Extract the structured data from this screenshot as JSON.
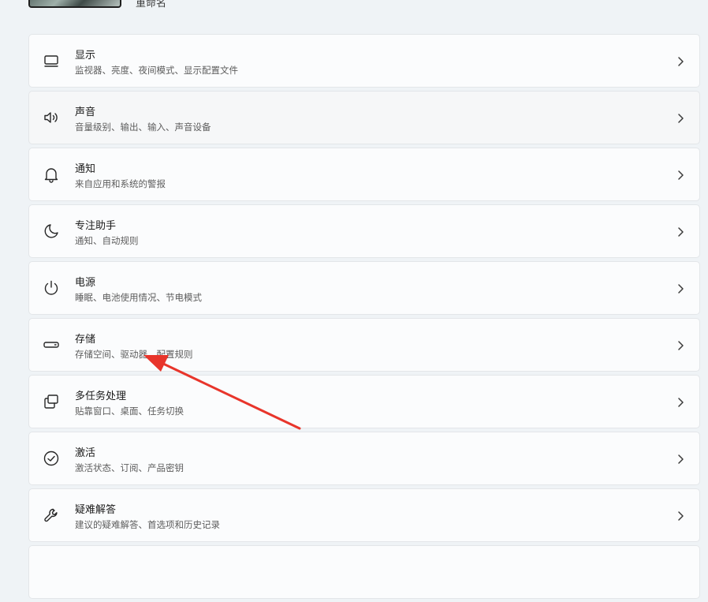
{
  "header": {
    "rename_label": "重命名"
  },
  "settings": [
    {
      "key": "display",
      "icon": "monitor-icon",
      "title": "显示",
      "subtitle": "监视器、亮度、夜间模式、显示配置文件"
    },
    {
      "key": "sound",
      "icon": "speaker-icon",
      "title": "声音",
      "subtitle": "音量级别、输出、输入、声音设备"
    },
    {
      "key": "notifications",
      "icon": "bell-icon",
      "title": "通知",
      "subtitle": "来自应用和系统的警报"
    },
    {
      "key": "focus-assist",
      "icon": "moon-icon",
      "title": "专注助手",
      "subtitle": "通知、自动规则"
    },
    {
      "key": "power",
      "icon": "power-icon",
      "title": "电源",
      "subtitle": "睡眠、电池使用情况、节电模式"
    },
    {
      "key": "storage",
      "icon": "storage-drive-icon",
      "title": "存储",
      "subtitle": "存储空间、驱动器、配置规则"
    },
    {
      "key": "multitasking",
      "icon": "multitasking-windows-icon",
      "title": "多任务处理",
      "subtitle": "贴靠窗口、桌面、任务切换"
    },
    {
      "key": "activation",
      "icon": "check-circle-icon",
      "title": "激活",
      "subtitle": "激活状态、订阅、产品密钥"
    },
    {
      "key": "troubleshoot",
      "icon": "wrench-icon",
      "title": "疑难解答",
      "subtitle": "建议的疑难解答、首选项和历史记录"
    }
  ],
  "colors": {
    "background": "#eff3f6",
    "card": "#fbfcfd",
    "annotation_arrow": "#e8352b"
  }
}
